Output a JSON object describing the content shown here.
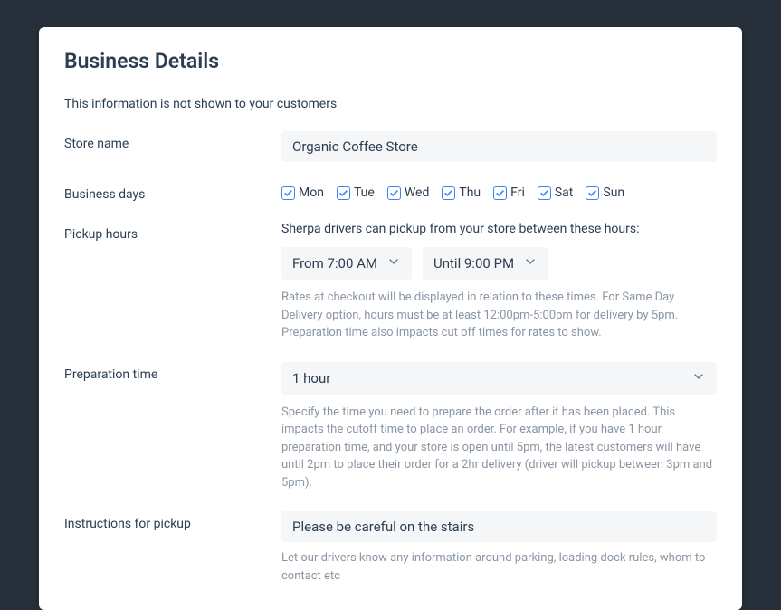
{
  "header": {
    "title": "Business Details",
    "subtitle": "This information is not shown to your customers"
  },
  "storeName": {
    "label": "Store name",
    "value": "Organic Coffee Store"
  },
  "businessDays": {
    "label": "Business days",
    "days": [
      {
        "short": "Mon",
        "checked": true
      },
      {
        "short": "Tue",
        "checked": true
      },
      {
        "short": "Wed",
        "checked": true
      },
      {
        "short": "Thu",
        "checked": true
      },
      {
        "short": "Fri",
        "checked": true
      },
      {
        "short": "Sat",
        "checked": true
      },
      {
        "short": "Sun",
        "checked": true
      }
    ]
  },
  "pickupHours": {
    "label": "Pickup hours",
    "description": "Sherpa drivers can pickup from your store between these hours:",
    "from": "From 7:00 AM",
    "until": "Until 9:00 PM",
    "help": "Rates at checkout will be displayed in relation to these times. For Same Day Delivery option, hours must be at least 12:00pm-5:00pm for delivery by 5pm. Preparation time also impacts cut off times for rates to show."
  },
  "preparationTime": {
    "label": "Preparation time",
    "value": "1 hour",
    "help": "Specify the time you need to prepare the order after it has been placed. This impacts the cutoff time to place an order. For example, if you have 1 hour preparation time, and your store is open until 5pm, the latest customers will have until 2pm to place their order for a 2hr delivery (driver will pickup between 3pm and 5pm)."
  },
  "instructions": {
    "label": "Instructions for pickup",
    "value": "Please be careful on the stairs",
    "help": "Let our drivers know any information around parking, loading dock rules, whom to contact etc"
  }
}
